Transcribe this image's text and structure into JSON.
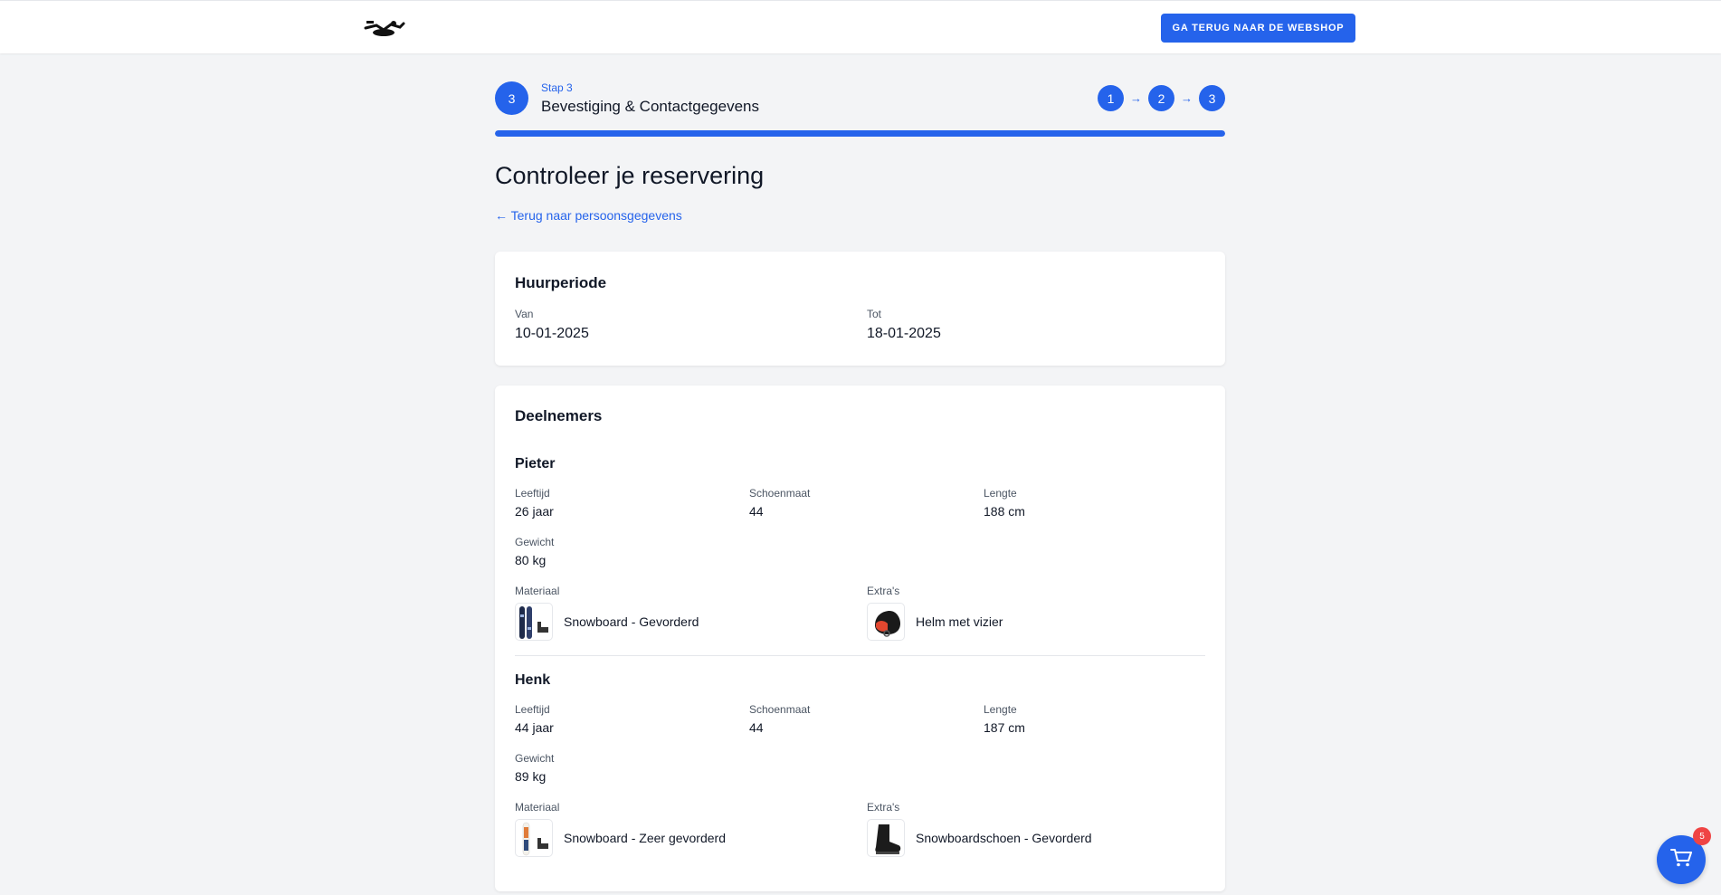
{
  "header": {
    "logo_icon": "ski-logo-icon",
    "shop_button": "GA TERUG NAAR DE WEBSHOP"
  },
  "stepper": {
    "current_number": "3",
    "step_label": "Stap 3",
    "step_title": "Bevestiging & Contactgegevens",
    "steps": [
      "1",
      "2",
      "3"
    ],
    "arrow_icon": "arrow-right-icon",
    "progress_fraction": 1.0,
    "accent_color": "#2563eb"
  },
  "page": {
    "title": "Controleer je reservering",
    "back_link": "← Terug naar persoonsgegevens"
  },
  "rental_period": {
    "title": "Huurperiode",
    "from_label": "Van",
    "from_value": "10-01-2025",
    "to_label": "Tot",
    "to_value": "18-01-2025"
  },
  "participants": {
    "title": "Deelnemers",
    "people": [
      {
        "name": "Pieter",
        "age_label": "Leeftijd",
        "age": "26 jaar",
        "shoe_label": "Schoenmaat",
        "shoe": "44",
        "height_label": "Lengte",
        "height": "188 cm",
        "weight_label": "Gewicht",
        "weight": "80 kg",
        "material_label": "Materiaal",
        "material": "Snowboard - Gevorderd",
        "material_icon": "snowboard-icon",
        "extras_label": "Extra's",
        "extra": "Helm met vizier",
        "extra_icon": "helmet-icon"
      },
      {
        "name": "Henk",
        "age_label": "Leeftijd",
        "age": "44 jaar",
        "shoe_label": "Schoenmaat",
        "shoe": "44",
        "height_label": "Lengte",
        "height": "187 cm",
        "weight_label": "Gewicht",
        "weight": "89 kg",
        "material_label": "Materiaal",
        "material": "Snowboard - Zeer gevorderd",
        "material_icon": "snowboard-icon",
        "extras_label": "Extra's",
        "extra": "Snowboardschoen - Gevorderd",
        "extra_icon": "boot-icon"
      }
    ]
  },
  "cart": {
    "icon": "cart-icon",
    "count": "5",
    "badge_color": "#ef4444"
  }
}
